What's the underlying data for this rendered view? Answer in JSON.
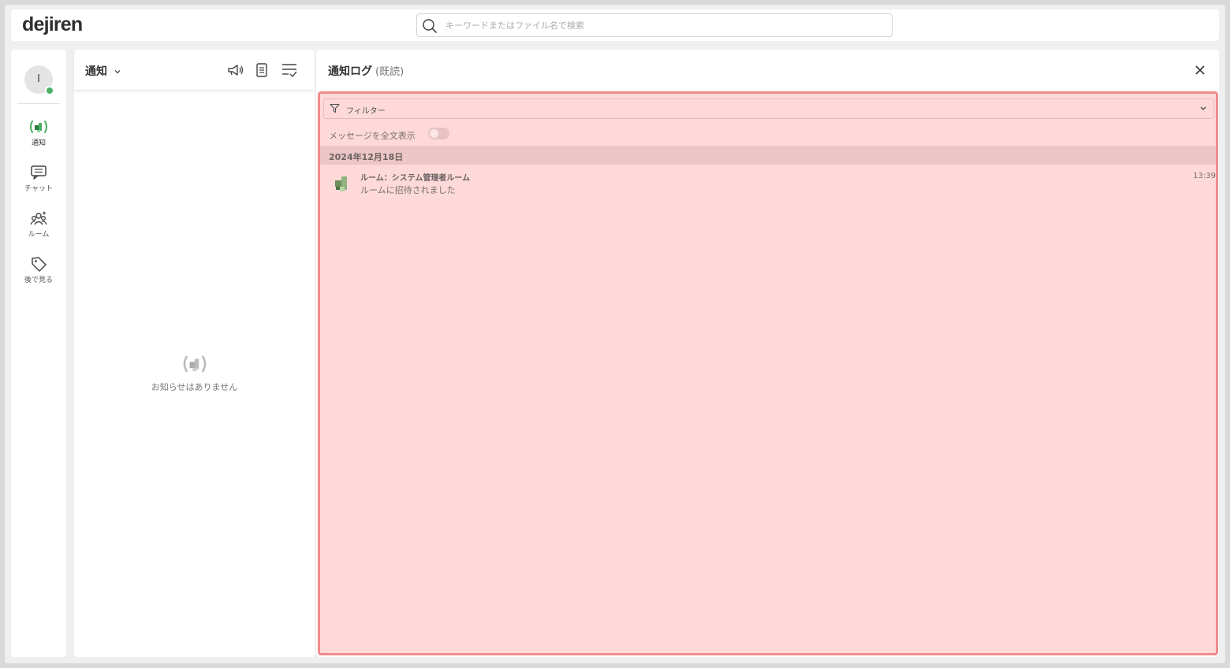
{
  "header": {
    "logo": "dejiren",
    "search_placeholder": "キーワードまたはファイル名で検索"
  },
  "rail": {
    "avatar_initial": "I",
    "items": [
      {
        "label": "通知",
        "icon": "notification-icon",
        "active": true
      },
      {
        "label": "チャット",
        "icon": "chat-icon"
      },
      {
        "label": "ルーム",
        "icon": "room-icon"
      },
      {
        "label": "後で見る",
        "icon": "tag-icon"
      }
    ]
  },
  "notifications": {
    "title": "通知",
    "empty_message": "お知らせはありません"
  },
  "log": {
    "title": "通知ログ",
    "subtitle": "(既読)",
    "filter_label": "フィルター",
    "fulltext_label": "メッセージを全文表示",
    "date": "2024年12月18日",
    "entries": [
      {
        "room": "ルーム：システム管理者ルーム",
        "message": "ルームに招待されました",
        "time": "13:39"
      }
    ]
  },
  "colors": {
    "accent": "#4caf63",
    "highlight_bg": "#fdd9d9",
    "highlight_border": "#f08b8b"
  }
}
